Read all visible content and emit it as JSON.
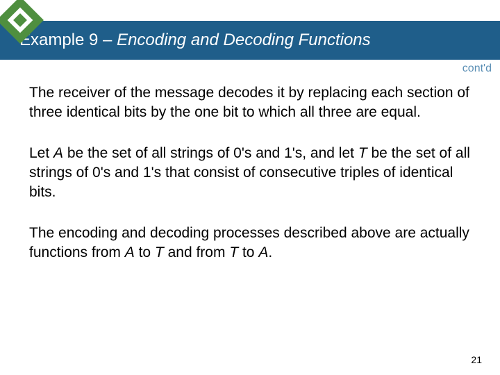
{
  "header": {
    "prefix": "Example 9 – ",
    "title_italic": "Encoding and Decoding Functions",
    "contd": "cont'd"
  },
  "body": {
    "p1_a": "The receiver of the message decodes it by replacing each section of three identical bits by the one bit to which all three are equal.",
    "p2_a": "Let ",
    "p2_b": "A",
    "p2_c": " be the set of all strings of 0's and 1's, and let ",
    "p2_d": "T",
    "p2_e": " be the set of all strings of 0's and 1's that consist of consecutive triples of identical bits.",
    "p3_a": "The encoding and decoding processes described above are actually functions from ",
    "p3_b": "A",
    "p3_c": " to ",
    "p3_d": "T",
    "p3_e": " and from ",
    "p3_f": "T",
    "p3_g": " to ",
    "p3_h": "A",
    "p3_i": "."
  },
  "page": "21"
}
